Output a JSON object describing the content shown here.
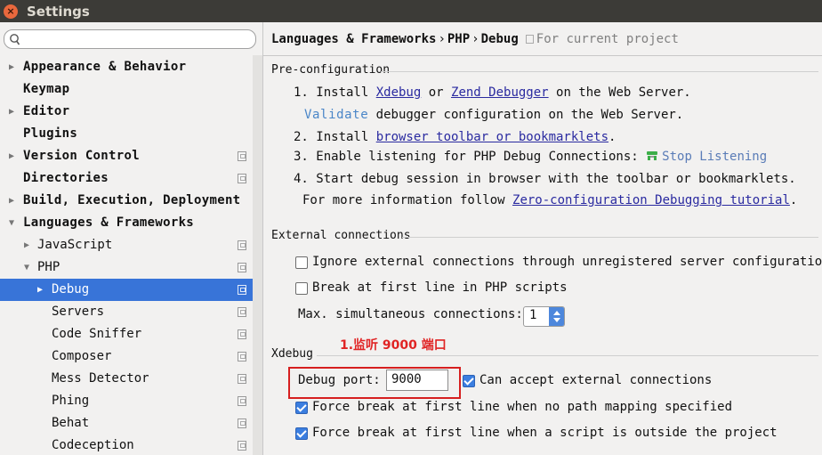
{
  "window": {
    "title": "Settings",
    "close_symbol": "×"
  },
  "search": {
    "placeholder": ""
  },
  "tree": [
    {
      "label": "Appearance & Behavior",
      "level": 0,
      "bold": true,
      "arrow": "▶",
      "project": false,
      "selected": false
    },
    {
      "label": "Keymap",
      "level": 0,
      "bold": true,
      "arrow": "",
      "project": false,
      "selected": false
    },
    {
      "label": "Editor",
      "level": 0,
      "bold": true,
      "arrow": "▶",
      "project": false,
      "selected": false
    },
    {
      "label": "Plugins",
      "level": 0,
      "bold": true,
      "arrow": "",
      "project": false,
      "selected": false
    },
    {
      "label": "Version Control",
      "level": 0,
      "bold": true,
      "arrow": "▶",
      "project": true,
      "selected": false
    },
    {
      "label": "Directories",
      "level": 0,
      "bold": true,
      "arrow": "",
      "project": true,
      "selected": false
    },
    {
      "label": "Build, Execution, Deployment",
      "level": 0,
      "bold": true,
      "arrow": "▶",
      "project": false,
      "selected": false
    },
    {
      "label": "Languages & Frameworks",
      "level": 0,
      "bold": true,
      "arrow": "▼",
      "project": false,
      "selected": false
    },
    {
      "label": "JavaScript",
      "level": 1,
      "bold": false,
      "arrow": "▶",
      "project": true,
      "selected": false
    },
    {
      "label": "PHP",
      "level": 1,
      "bold": false,
      "arrow": "▼",
      "project": true,
      "selected": false
    },
    {
      "label": "Debug",
      "level": 2,
      "bold": false,
      "arrow": "▶",
      "project": true,
      "selected": true
    },
    {
      "label": "Servers",
      "level": 2,
      "bold": false,
      "arrow": "",
      "project": true,
      "selected": false
    },
    {
      "label": "Code Sniffer",
      "level": 2,
      "bold": false,
      "arrow": "",
      "project": true,
      "selected": false
    },
    {
      "label": "Composer",
      "level": 2,
      "bold": false,
      "arrow": "",
      "project": true,
      "selected": false
    },
    {
      "label": "Mess Detector",
      "level": 2,
      "bold": false,
      "arrow": "",
      "project": true,
      "selected": false
    },
    {
      "label": "Phing",
      "level": 2,
      "bold": false,
      "arrow": "",
      "project": true,
      "selected": false
    },
    {
      "label": "Behat",
      "level": 2,
      "bold": false,
      "arrow": "",
      "project": true,
      "selected": false
    },
    {
      "label": "Codeception",
      "level": 2,
      "bold": false,
      "arrow": "",
      "project": true,
      "selected": false
    }
  ],
  "breadcrumb": {
    "part1": "Languages & Frameworks",
    "part2": "PHP",
    "part3": "Debug",
    "separator": "›",
    "note": "For current project"
  },
  "preconfig": {
    "header": "Pre-configuration",
    "step1_pre": "1. Install ",
    "step1_link1": "Xdebug",
    "step1_or": " or ",
    "step1_link2": "Zend Debugger",
    "step1_post": " on the Web Server.",
    "validate_link": "Validate",
    "validate_text": " debugger configuration on the Web Server.",
    "step2_pre": "2. Install ",
    "step2_link": "browser toolbar or bookmarklets",
    "step2_post": ".",
    "step3_pre": "3. Enable listening for PHP Debug Connections: ",
    "step3_action": "Stop Listening",
    "step4": "4. Start debug session in browser with the toolbar or bookmarklets.",
    "more_pre": "For more information follow ",
    "more_link": "Zero-configuration Debugging tutorial",
    "more_post": "."
  },
  "external": {
    "header": "External connections",
    "ignore_label": "Ignore external connections through unregistered server configurations",
    "ignore_checked": false,
    "break_label": "Break at first line in PHP scripts",
    "break_checked": false,
    "max_label": "Max. simultaneous connections:",
    "max_value": "1"
  },
  "annotation": "1.监听 9000 端口",
  "xdebug": {
    "header": "Xdebug",
    "port_label": "Debug port:",
    "port_value": "9000",
    "accept_label": "Can accept external connections",
    "accept_checked": true,
    "force_nomap_label": "Force break at first line when no path mapping specified",
    "force_nomap_checked": true,
    "force_outside_label": "Force break at first line when a script is outside the project",
    "force_outside_checked": true
  },
  "colors": {
    "selection": "#3874d8",
    "link": "#2a2aa0",
    "annotation": "#e02424",
    "checkbox_on": "#3b7ee0"
  }
}
